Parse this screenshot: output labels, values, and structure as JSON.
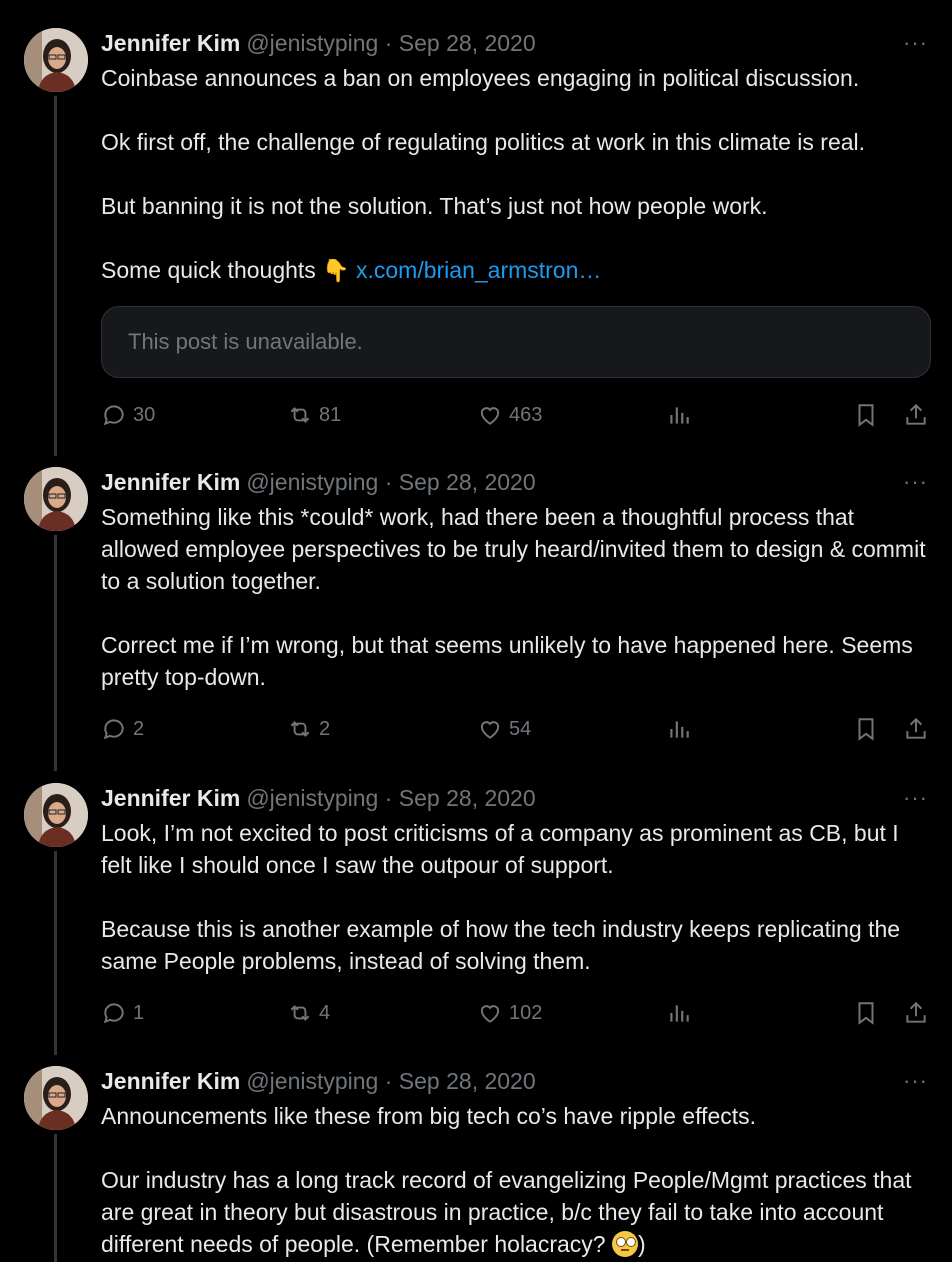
{
  "tweets": [
    {
      "author_name": "Jennifer Kim",
      "handle_date": "@jenistyping · Sep 28, 2020",
      "more_label": "···",
      "paragraphs": [
        "Coinbase announces a ban on employees engaging in political discussion.",
        "Ok first off, the challenge of regulating politics at work in this climate is real.",
        "But banning it is not the solution. That’s just not how people work."
      ],
      "last_paragraph_text": "Some quick thoughts",
      "last_paragraph_emoji": "👇",
      "link_text": "x.com/brian_armstron…",
      "quote_unavailable": "This post is unavailable.",
      "replies": "30",
      "reposts": "81",
      "likes": "463"
    },
    {
      "author_name": "Jennifer Kim",
      "handle_date": "@jenistyping · Sep 28, 2020",
      "more_label": "···",
      "paragraphs": [
        "Something like this *could* work, had there been a thoughtful process that allowed employee perspectives to be truly heard/invited them to design & commit to a solution together.",
        "Correct me if I’m wrong, but that seems unlikely to have happened here. Seems pretty top-down."
      ],
      "replies": "2",
      "reposts": "2",
      "likes": "54"
    },
    {
      "author_name": "Jennifer Kim",
      "handle_date": "@jenistyping · Sep 28, 2020",
      "more_label": "···",
      "paragraphs": [
        "Look, I’m not excited to post criticisms of a company as prominent as CB, but I felt like I should once I saw the outpour of support.",
        "Because this is another example of how the tech industry keeps replicating the same People problems, instead of solving them."
      ],
      "replies": "1",
      "reposts": "4",
      "likes": "102"
    },
    {
      "author_name": "Jennifer Kim",
      "handle_date": "@jenistyping · Sep 28, 2020",
      "more_label": "···",
      "paragraphs": [
        "Announcements like these from big tech co’s have ripple effects."
      ],
      "last_paragraph_text": "Our industry has a long track record of evangelizing People/Mgmt practices that are great in theory but disastrous in practice, b/c they fail to take into account different needs of people. (Remember holacracy?",
      "last_paragraph_suffix": ")",
      "last_paragraph_emoji_name": "face-with-rolling-eyes-icon"
    }
  ],
  "colors": {
    "background": "#000000",
    "text": "#e7e9ea",
    "muted": "#71767b",
    "link": "#1d9bf0",
    "thread_line": "#333639"
  }
}
